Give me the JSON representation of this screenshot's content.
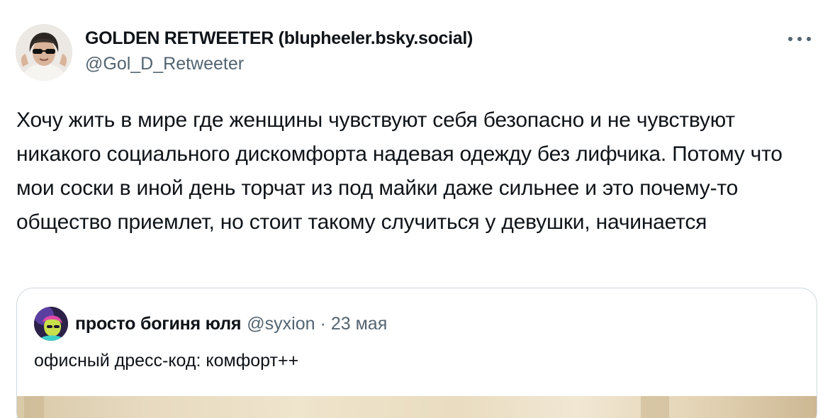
{
  "tweet": {
    "author": {
      "display_name": "GOLDEN RETWEETER (blupheeler.bsky.social)",
      "handle": "@Gol_D_Retweeter",
      "avatar_icon": "user-avatar-sunglasses"
    },
    "more_icon": "more-dots-icon",
    "text": "Хочу жить в мире где женщины чувствуют себя безопасно и не чувствуют никакого социального дискомфорта надевая одежду без лифчика. Потому что мои соски в иной день торчат из под майки даже сильнее и это почему-то общество приемлет, но стоит такому случиться у девушки, начинается"
  },
  "quote": {
    "author": {
      "display_name": "просто богиня юля",
      "handle": "@syxion",
      "avatar_icon": "user-avatar-neon"
    },
    "separator": "·",
    "date": "23 мая",
    "text": "офисный дресс-код: комфорт++",
    "media_icon": "photo-media"
  },
  "colors": {
    "text_primary": "#0f1419",
    "text_secondary": "#536471",
    "border": "#cfd9de"
  }
}
